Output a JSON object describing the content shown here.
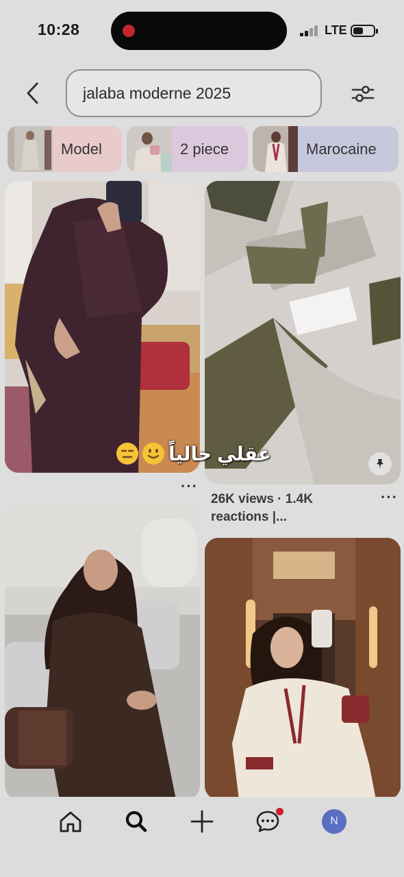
{
  "status_bar": {
    "time": "10:28",
    "network": "LTE",
    "battery_level": 0.45,
    "signal_bars": 2,
    "recording": true
  },
  "search": {
    "query": "jalaba moderne 2025",
    "back_icon": "chevron-left-icon",
    "filter_icon": "sliders-icon"
  },
  "chips": [
    {
      "label": "Model",
      "color": "#e8c9c9"
    },
    {
      "label": "2 piece",
      "color": "#dcc8dc"
    },
    {
      "label": "Marocaine",
      "color": "#c9c9dc"
    }
  ],
  "pins": {
    "p2": {
      "meta": "26K views · 1.4K reactions |..."
    },
    "p1": {
      "caption": "عقلي حالياً"
    },
    "more": "···"
  },
  "tab_bar": {
    "items": [
      "home-icon",
      "search-icon",
      "plus-icon",
      "messages-icon",
      "profile-avatar"
    ],
    "avatar_initial": "N",
    "avatar_color": "#5a6fc2",
    "notification_color": "#d0202c"
  }
}
